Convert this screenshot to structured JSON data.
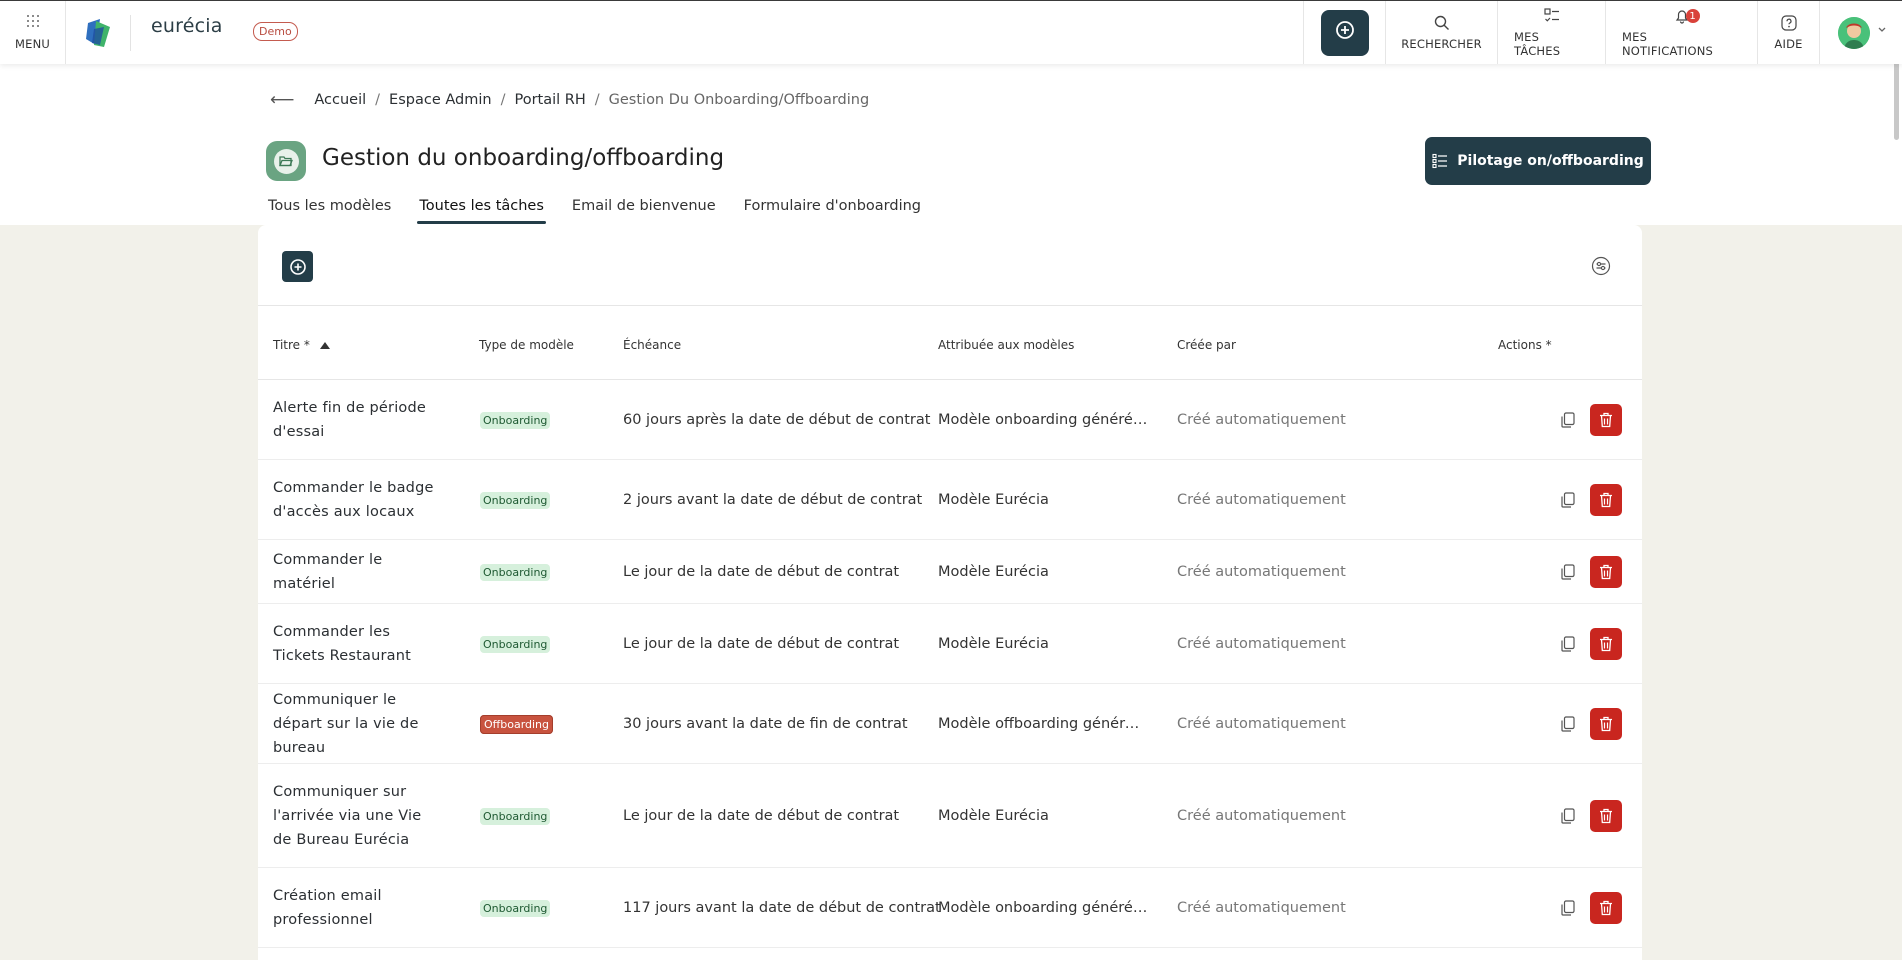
{
  "topbar": {
    "menu_label": "MENU",
    "brand": "eurécia",
    "demo_badge": "Demo",
    "search_label": "RECHERCHER",
    "tasks_label": "MES TÂCHES",
    "notifications_label": "MES NOTIFICATIONS",
    "notifications_count": "1",
    "help_label": "AIDE"
  },
  "breadcrumb": {
    "items": [
      "Accueil",
      "Espace Admin",
      "Portail RH"
    ],
    "separator": "/",
    "current": "Gestion Du Onboarding/Offboarding"
  },
  "page": {
    "title": "Gestion du onboarding/offboarding",
    "pilot_button": "Pilotage on/offboarding"
  },
  "tabs": [
    {
      "label": "Tous les modèles",
      "active": false
    },
    {
      "label": "Toutes les tâches",
      "active": true
    },
    {
      "label": "Email de bienvenue",
      "active": false
    },
    {
      "label": "Formulaire d'onboarding",
      "active": false
    }
  ],
  "table": {
    "columns": {
      "title": "Titre *",
      "type": "Type de modèle",
      "deadline": "Échéance",
      "assigned": "Attribuée aux modèles",
      "created_by": "Créée par",
      "actions": "Actions *"
    },
    "sort": {
      "column": "title",
      "direction": "asc"
    },
    "rows": [
      {
        "title": "Alerte fin de période d'essai",
        "type": "Onboarding",
        "deadline": "60 jours après la date de début de contrat",
        "assigned": "Modèle onboarding généré au…",
        "created_by": "Créé automatiquement"
      },
      {
        "title": "Commander le badge d'accès aux locaux",
        "type": "Onboarding",
        "deadline": "2 jours avant la date de début de contrat",
        "assigned": "Modèle Eurécia",
        "created_by": "Créé automatiquement"
      },
      {
        "title": "Commander le matériel",
        "type": "Onboarding",
        "deadline": "Le jour de la date de début de contrat",
        "assigned": "Modèle Eurécia",
        "created_by": "Créé automatiquement"
      },
      {
        "title": "Commander les Tickets Restaurant",
        "type": "Onboarding",
        "deadline": "Le jour de la date de début de contrat",
        "assigned": "Modèle Eurécia",
        "created_by": "Créé automatiquement"
      },
      {
        "title": "Communiquer le départ sur la vie de bureau",
        "type": "Offboarding",
        "deadline": "30 jours avant la date de fin de contrat",
        "assigned": "Modèle offboarding généré au…",
        "created_by": "Créé automatiquement"
      },
      {
        "title": "Communiquer sur l'arrivée via une Vie de Bureau Eurécia",
        "type": "Onboarding",
        "deadline": "Le jour de la date de début de contrat",
        "assigned": "Modèle Eurécia",
        "created_by": "Créé automatiquement"
      },
      {
        "title": "Création email professionnel",
        "type": "Onboarding",
        "deadline": "117 jours avant la date de début de contrat",
        "assigned": "Modèle onboarding généré au…",
        "created_by": "Créé automatiquement"
      }
    ]
  },
  "icons": {
    "menu": "grid-icon",
    "add": "plus-circle-icon",
    "search": "search-icon",
    "tasks": "checklist-icon",
    "notifications": "bell-icon",
    "help": "question-icon",
    "filter": "filter-icon",
    "copy": "copy-icon",
    "delete": "trash-icon",
    "back": "arrow-left-icon"
  },
  "colors": {
    "primary": "#233d48",
    "danger": "#c9261f",
    "onboarding_bg": "#d6f0dc",
    "offboarding_bg": "#c8533f",
    "page_bg": "#f2f1ea"
  }
}
